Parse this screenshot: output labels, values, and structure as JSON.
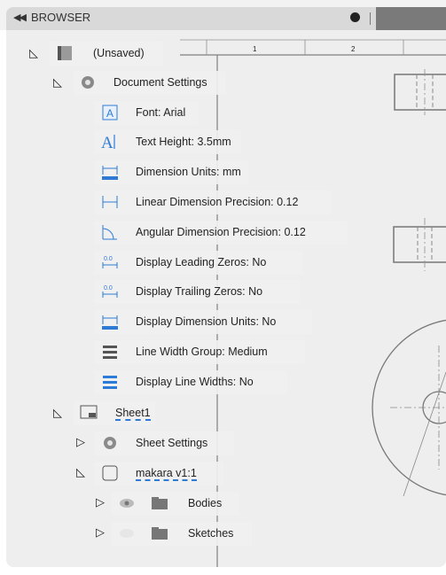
{
  "header": {
    "title": "BROWSER"
  },
  "tree": {
    "root": {
      "label": "(Unsaved)"
    },
    "document_settings": {
      "label": "Document Settings",
      "items": [
        {
          "label": "Font: Arial",
          "icon": "font-icon"
        },
        {
          "label": "Text Height: 3.5mm",
          "icon": "text-height-icon"
        },
        {
          "label": "Dimension Units: mm",
          "icon": "dimension-units-icon"
        },
        {
          "label": "Linear Dimension Precision: 0.12",
          "icon": "linear-dimension-icon"
        },
        {
          "label": "Angular Dimension Precision: 0.12",
          "icon": "angular-dimension-icon"
        },
        {
          "label": "Display Leading Zeros: No",
          "icon": "leading-zeros-icon"
        },
        {
          "label": "Display Trailing Zeros: No",
          "icon": "trailing-zeros-icon"
        },
        {
          "label": "Display Dimension Units: No",
          "icon": "display-units-icon"
        },
        {
          "label": "Line Width Group: Medium",
          "icon": "line-width-group-icon"
        },
        {
          "label": "Display Line Widths: No",
          "icon": "line-widths-icon"
        }
      ]
    },
    "sheet": {
      "label": "Sheet1"
    },
    "sheet_settings": {
      "label": "Sheet Settings"
    },
    "view": {
      "label": "makara v1:1"
    },
    "bodies": {
      "label": "Bodies"
    },
    "sketches": {
      "label": "Sketches"
    }
  },
  "ruler": {
    "tick1": "1",
    "tick2": "2"
  },
  "colors": {
    "accent": "#2e7bd6",
    "panel": "#dedede",
    "icon_gray": "#8a8a8a"
  }
}
